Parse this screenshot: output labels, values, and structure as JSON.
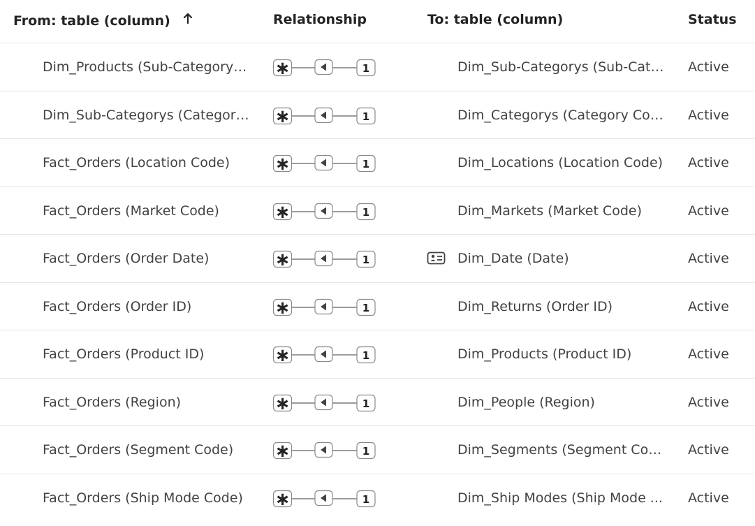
{
  "header": {
    "from_label": "From: table (column)",
    "relationship_label": "Relationship",
    "to_label": "To: table (column)",
    "status_label": "Status",
    "sort_icon": "arrow-up-icon"
  },
  "relationship_symbol": {
    "many": "∗",
    "one": "1",
    "direction_icon": "triangle-left-icon"
  },
  "rows": [
    {
      "from": "Dim_Products (Sub-Category ...",
      "to": "Dim_Sub-Categorys (Sub-Cate...",
      "status": "Active",
      "to_icon": ""
    },
    {
      "from": "Dim_Sub-Categorys (Category...",
      "to": "Dim_Categorys (Category Code)",
      "status": "Active",
      "to_icon": ""
    },
    {
      "from": "Fact_Orders (Location Code)",
      "to": "Dim_Locations (Location Code)",
      "status": "Active",
      "to_icon": ""
    },
    {
      "from": "Fact_Orders (Market Code)",
      "to": "Dim_Markets (Market Code)",
      "status": "Active",
      "to_icon": ""
    },
    {
      "from": "Fact_Orders (Order Date)",
      "to": "Dim_Date (Date)",
      "status": "Active",
      "to_icon": "date-table-icon"
    },
    {
      "from": "Fact_Orders (Order ID)",
      "to": "Dim_Returns (Order ID)",
      "status": "Active",
      "to_icon": ""
    },
    {
      "from": "Fact_Orders (Product ID)",
      "to": "Dim_Products (Product ID)",
      "status": "Active",
      "to_icon": ""
    },
    {
      "from": "Fact_Orders (Region)",
      "to": "Dim_People (Region)",
      "status": "Active",
      "to_icon": ""
    },
    {
      "from": "Fact_Orders (Segment Code)",
      "to": "Dim_Segments (Segment Code)",
      "status": "Active",
      "to_icon": ""
    },
    {
      "from": "Fact_Orders (Ship Mode Code)",
      "to": "Dim_Ship Modes (Ship Mode ...",
      "status": "Active",
      "to_icon": ""
    }
  ]
}
